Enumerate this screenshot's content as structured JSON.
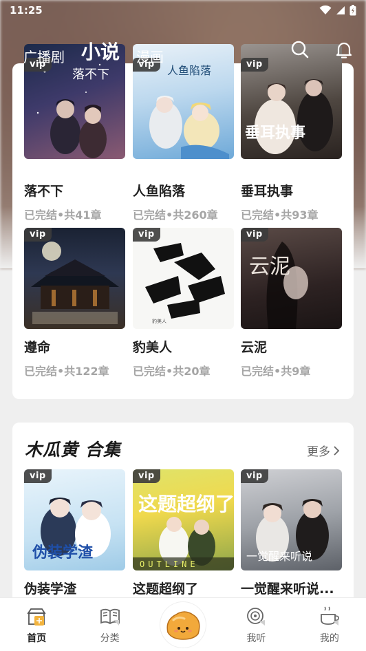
{
  "status_bar": {
    "time": "11:25"
  },
  "top_nav": {
    "tabs": [
      {
        "label": "广播剧"
      },
      {
        "label": "小说"
      },
      {
        "label": "漫画"
      }
    ]
  },
  "books_top": [
    {
      "title": "落不下",
      "meta": "已完结•共41章",
      "badge": "vip"
    },
    {
      "title": "人鱼陷落",
      "meta": "已完结•共260章",
      "badge": "vip"
    },
    {
      "title": "垂耳执事",
      "meta": "已完结•共93章",
      "badge": "vip"
    },
    {
      "title": "遵命",
      "meta": "已完结•共122章",
      "badge": "vip"
    },
    {
      "title": "豹美人",
      "meta": "已完结•共20章",
      "badge": "vip"
    },
    {
      "title": "云泥",
      "meta": "已完结•共9章",
      "badge": "vip"
    }
  ],
  "collection": {
    "title": "木瓜黄 合集",
    "more_label": "更多",
    "books": [
      {
        "title": "伪装学渣",
        "badge": "vip",
        "cover_text": "伪装学渣"
      },
      {
        "title": "这题超纲了",
        "badge": "vip",
        "cover_text": "这题超纲了"
      },
      {
        "title": "一觉醒来听说...",
        "badge": "vip",
        "cover_text": "一觉醒来听说"
      }
    ]
  },
  "cover_text": {
    "b1": "落不下",
    "b2": "人鱼陷落",
    "b3": "垂耳执事",
    "b5": "豹美人",
    "b6": "云泥",
    "b8": "OUTLINE"
  },
  "bottom_nav": [
    {
      "label": "首页",
      "icon": "home-icon",
      "active": true
    },
    {
      "label": "分类",
      "icon": "book-icon",
      "active": false
    },
    {
      "label": "",
      "icon": "bun-mascot-icon",
      "active": false
    },
    {
      "label": "我听",
      "icon": "listen-icon",
      "active": false
    },
    {
      "label": "我的",
      "icon": "profile-icon",
      "active": false
    }
  ],
  "colors": {
    "accent_orange": "#f2b33d",
    "text_primary": "#222222",
    "text_meta": "#a5a5a5"
  }
}
